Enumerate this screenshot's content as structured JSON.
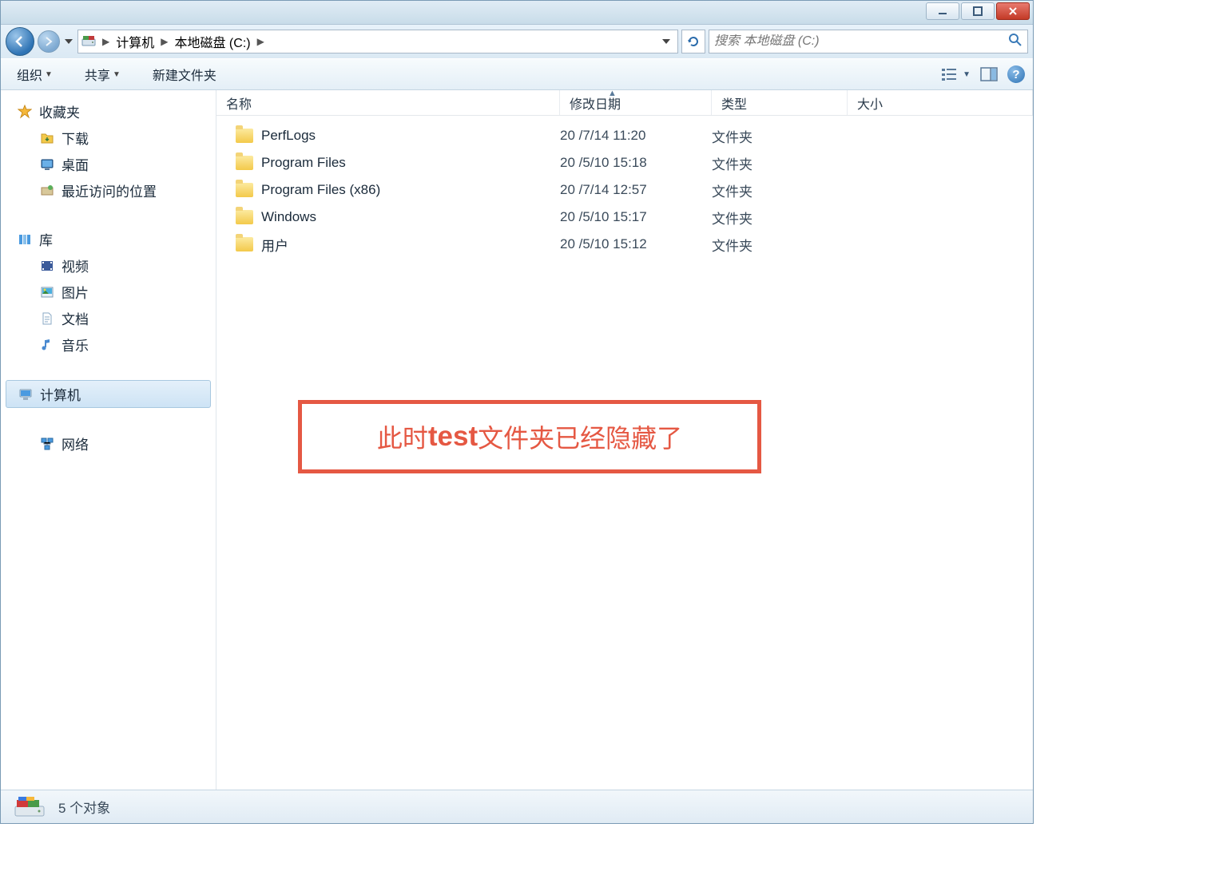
{
  "breadcrumb": {
    "item1": "计算机",
    "item2": "本地磁盘 (C:)"
  },
  "search": {
    "placeholder": "搜索 本地磁盘 (C:)"
  },
  "toolbar": {
    "organize": "组织",
    "share": "共享",
    "newfolder": "新建文件夹"
  },
  "sidebar": {
    "favorites": {
      "label": "收藏夹",
      "downloads": "下载",
      "desktop": "桌面",
      "recent": "最近访问的位置"
    },
    "libraries": {
      "label": "库",
      "videos": "视频",
      "pictures": "图片",
      "documents": "文档",
      "music": "音乐"
    },
    "computer": "计算机",
    "network": "网络"
  },
  "columns": {
    "name": "名称",
    "modified": "修改日期",
    "type": "类型",
    "size": "大小"
  },
  "files": [
    {
      "name": "PerfLogs",
      "date": "20  /7/14 11:20",
      "type": "文件夹"
    },
    {
      "name": "Program Files",
      "date": "20  /5/10 15:18",
      "type": "文件夹"
    },
    {
      "name": "Program Files (x86)",
      "date": "20  /7/14 12:57",
      "type": "文件夹"
    },
    {
      "name": "Windows",
      "date": "20  /5/10 15:17",
      "type": "文件夹"
    },
    {
      "name": "用户",
      "date": "20  /5/10 15:12",
      "type": "文件夹"
    }
  ],
  "annotation": {
    "pre": "此时",
    "bold": "test",
    "post": "文件夹已经隐藏了"
  },
  "status": {
    "text": "5 个对象"
  }
}
